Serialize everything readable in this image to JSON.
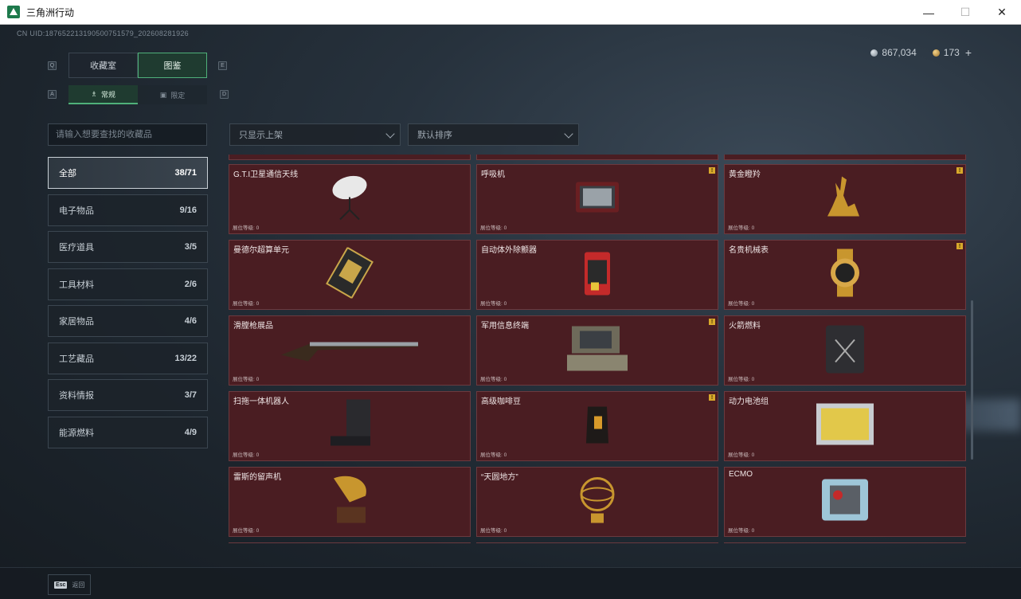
{
  "window": {
    "title": "三角洲行动",
    "minimize": "—",
    "maximize": "☐",
    "close": "✕"
  },
  "uid": "CN UID:18765221319050075157​9_202608281926",
  "currency": {
    "silver": "867,034",
    "gold": "173",
    "gold_plus": "+"
  },
  "keys": {
    "q": "Q",
    "e": "E",
    "l": "A",
    "r": "D"
  },
  "tabs": [
    {
      "label": "收藏室"
    },
    {
      "label": "图鉴"
    }
  ],
  "subtabs": [
    {
      "label": "常规",
      "icon": "♗"
    },
    {
      "label": "限定",
      "icon": "▣"
    }
  ],
  "search": {
    "placeholder": "请输入想要查找的收藏品"
  },
  "filters": {
    "shelf": "只显示上架",
    "sort": "默认排序"
  },
  "categories": [
    {
      "label": "全部",
      "count": "38/71"
    },
    {
      "label": "电子物品",
      "count": "9/16"
    },
    {
      "label": "医疗道具",
      "count": "3/5"
    },
    {
      "label": "工具材料",
      "count": "2/6"
    },
    {
      "label": "家居物品",
      "count": "4/6"
    },
    {
      "label": "工艺藏品",
      "count": "13/22"
    },
    {
      "label": "资料情报",
      "count": "3/7"
    },
    {
      "label": "能源燃料",
      "count": "4/9"
    }
  ],
  "level_label": "展位等级: 0",
  "items": [
    {
      "name": "G.T.I卫星通信天线",
      "badge": false,
      "icon": "satellite-dish-icon"
    },
    {
      "name": "呼吸机",
      "badge": true,
      "icon": "ventilator-icon"
    },
    {
      "name": "黄金瞪羚",
      "badge": true,
      "icon": "golden-gazelle-icon"
    },
    {
      "name": "曼德尔超算单元",
      "badge": false,
      "icon": "supercomputer-unit-icon"
    },
    {
      "name": "自动体外除颤器",
      "badge": false,
      "icon": "defibrillator-icon"
    },
    {
      "name": "名贵机械表",
      "badge": true,
      "icon": "mechanical-watch-icon"
    },
    {
      "name": "滑膛枪展品",
      "badge": false,
      "icon": "musket-icon"
    },
    {
      "name": "军用信息终端",
      "badge": true,
      "icon": "military-terminal-icon"
    },
    {
      "name": "火箭燃料",
      "badge": false,
      "icon": "rocket-fuel-icon"
    },
    {
      "name": "扫拖一体机器人",
      "badge": false,
      "icon": "robot-mop-icon"
    },
    {
      "name": "高级咖啡豆",
      "badge": true,
      "icon": "coffee-bag-icon"
    },
    {
      "name": "动力电池组",
      "badge": false,
      "icon": "battery-pack-icon"
    },
    {
      "name": "雷斯的留声机",
      "badge": false,
      "icon": "gramophone-icon"
    },
    {
      "name": "“天圆地方”",
      "badge": false,
      "icon": "armillary-sphere-icon"
    },
    {
      "name": "ECMO",
      "badge": false,
      "icon": "ecmo-machine-icon"
    }
  ],
  "badge_mark": "!",
  "footer": {
    "key": "Esc",
    "label": "返回"
  }
}
